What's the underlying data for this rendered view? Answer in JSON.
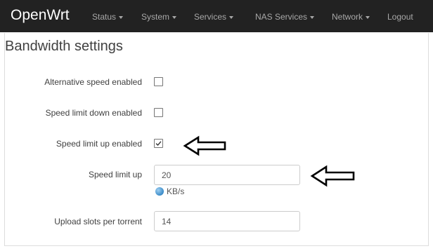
{
  "navbar": {
    "brand": "OpenWrt",
    "items": [
      {
        "label": "Status",
        "has_dropdown": true
      },
      {
        "label": "System",
        "has_dropdown": true
      },
      {
        "label": "Services",
        "has_dropdown": true
      },
      {
        "label": "NAS Services",
        "has_dropdown": true
      },
      {
        "label": "Network",
        "has_dropdown": true
      },
      {
        "label": "Logout",
        "has_dropdown": false
      }
    ]
  },
  "section": {
    "title": "Bandwidth settings"
  },
  "fields": {
    "alt_speed": {
      "label": "Alternative speed enabled",
      "checked": false
    },
    "speed_limit_down": {
      "label": "Speed limit down enabled",
      "checked": false
    },
    "speed_limit_up_enabled": {
      "label": "Speed limit up enabled",
      "checked": true
    },
    "speed_limit_up": {
      "label": "Speed limit up",
      "value": "20",
      "unit": "KB/s"
    },
    "upload_slots": {
      "label": "Upload slots per torrent",
      "value": "14"
    }
  },
  "icons": {
    "help": "help-circle-icon",
    "annotation": "left-arrow-icon",
    "checkmark": "checkmark-icon"
  },
  "colors": {
    "navbar_bg": "#222222",
    "brand": "#ffffff",
    "nav_text": "#a8a8a8",
    "help_icon": "#3a8bc8"
  }
}
